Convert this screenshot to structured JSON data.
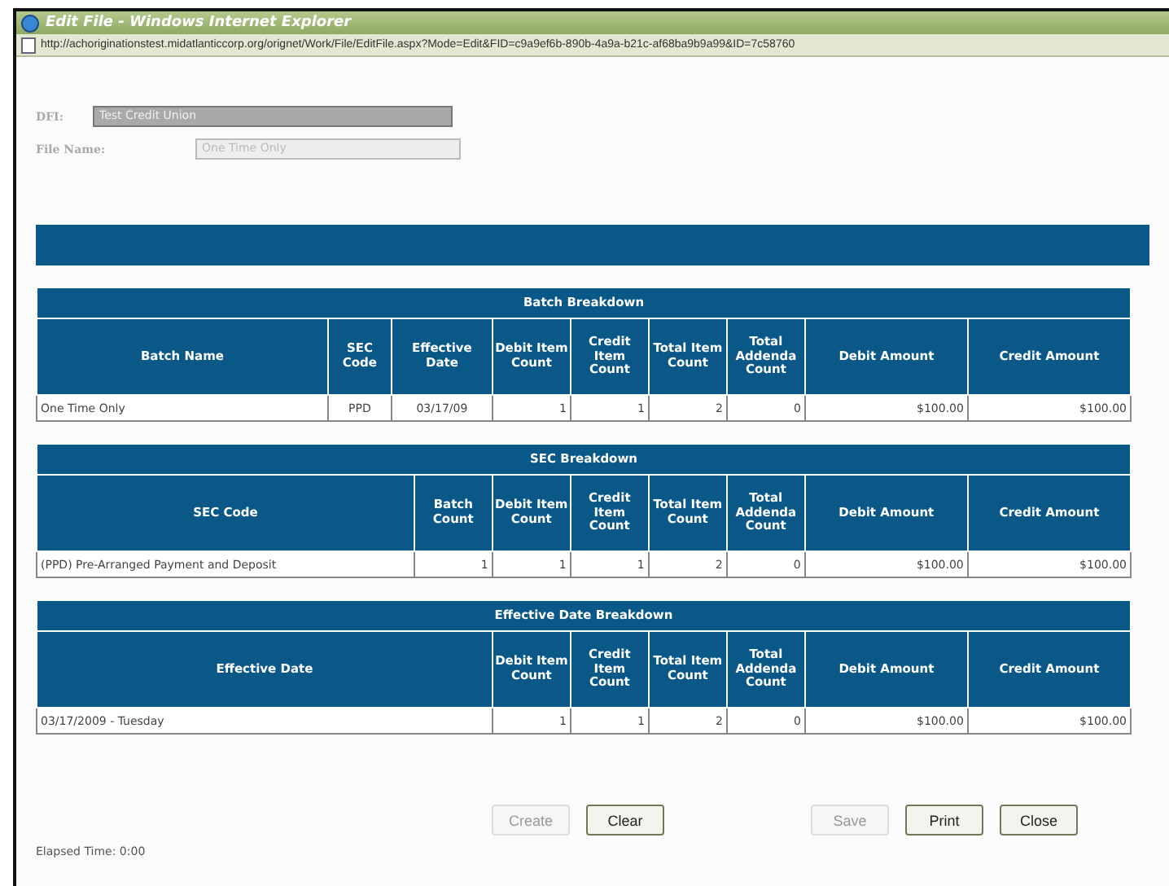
{
  "window": {
    "title": "Edit File - Windows Internet Explorer"
  },
  "address_bar": {
    "url": "http://achoriginationstest.midatlanticcorp.org/orignet/Work/File/EditFile.aspx?Mode=Edit&FID=c9a9ef6b-890b-4a9a-b21c-af68ba9b9a99&ID=7c58760"
  },
  "form": {
    "fields": [
      {
        "label": "DFI:",
        "value": "Test Credit Union",
        "kind": "select"
      },
      {
        "label": "File Name:",
        "value": "One Time Only",
        "kind": "text"
      }
    ]
  },
  "tables": [
    {
      "title": "Batch Breakdown",
      "columns": [
        {
          "label": "Batch Name",
          "kind": "name"
        },
        {
          "label": "SEC Code",
          "kind": "code"
        },
        {
          "label": "Effective Date",
          "kind": "date"
        },
        {
          "label": "Debit Item Count",
          "kind": "count"
        },
        {
          "label": "Credit Item Count",
          "kind": "count"
        },
        {
          "label": "Total Item Count",
          "kind": "count"
        },
        {
          "label": "Total Addenda Count",
          "kind": "count"
        },
        {
          "label": "Debit Amount",
          "kind": "amount"
        },
        {
          "label": "Credit Amount",
          "kind": "amount"
        }
      ],
      "rows": [
        [
          "One Time Only",
          "PPD",
          "03/17/09",
          "1",
          "1",
          "2",
          "0",
          "$100.00",
          "$100.00"
        ]
      ]
    },
    {
      "title": "SEC Breakdown",
      "columns": [
        {
          "label": "SEC Code",
          "kind": "name"
        },
        {
          "label": "Batch Count",
          "kind": "count"
        },
        {
          "label": "Debit Item Count",
          "kind": "count"
        },
        {
          "label": "Credit Item Count",
          "kind": "count"
        },
        {
          "label": "Total Item Count",
          "kind": "count"
        },
        {
          "label": "Total Addenda Count",
          "kind": "count"
        },
        {
          "label": "Debit Amount",
          "kind": "amount"
        },
        {
          "label": "Credit Amount",
          "kind": "amount"
        }
      ],
      "rows": [
        [
          "(PPD) Pre-Arranged Payment and Deposit",
          "1",
          "1",
          "1",
          "2",
          "0",
          "$100.00",
          "$100.00"
        ]
      ]
    },
    {
      "title": "Effective Date Breakdown",
      "columns": [
        {
          "label": "Effective Date",
          "kind": "name"
        },
        {
          "label": "Debit Item Count",
          "kind": "count"
        },
        {
          "label": "Credit Item Count",
          "kind": "count"
        },
        {
          "label": "Total Item Count",
          "kind": "count"
        },
        {
          "label": "Total Addenda Count",
          "kind": "count"
        },
        {
          "label": "Debit Amount",
          "kind": "amount"
        },
        {
          "label": "Credit Amount",
          "kind": "amount"
        }
      ],
      "rows": [
        [
          "03/17/2009 - Tuesday",
          "1",
          "1",
          "2",
          "0",
          "$100.00",
          "$100.00"
        ]
      ]
    }
  ],
  "button_groups": [
    {
      "buttons": [
        {
          "label": "Create",
          "disabled": true
        },
        {
          "label": "Clear",
          "disabled": false
        }
      ]
    },
    {
      "buttons": [
        {
          "label": "Save",
          "disabled": true
        },
        {
          "label": "Print",
          "disabled": false
        },
        {
          "label": "Close",
          "disabled": false
        }
      ]
    }
  ],
  "status": {
    "elapsed": "Elapsed Time: 0:00"
  }
}
